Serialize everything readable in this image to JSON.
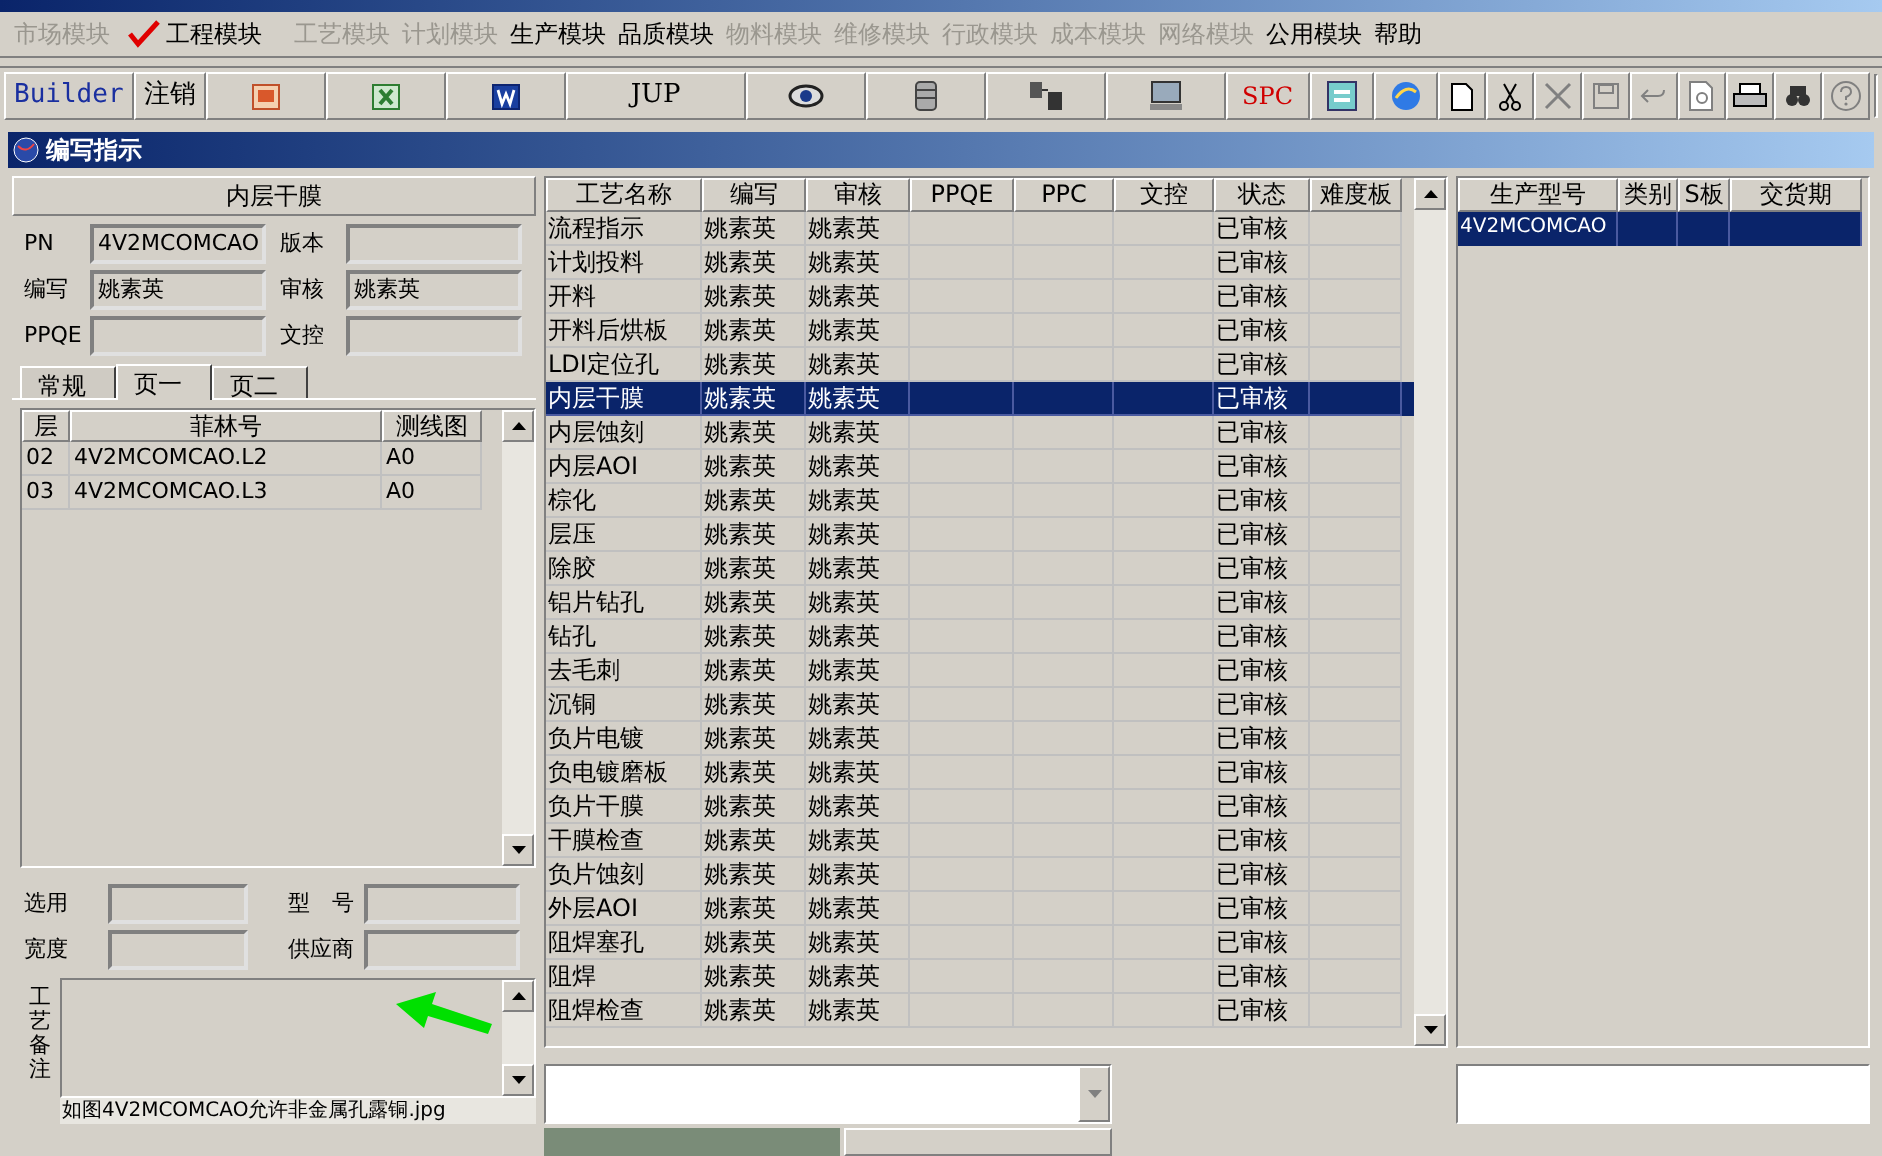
{
  "menu": [
    {
      "label": "市场模块",
      "disabled": true,
      "checked": false
    },
    {
      "label": "工程模块",
      "disabled": false,
      "checked": true
    },
    {
      "label": "工艺模块",
      "disabled": true,
      "checked": false
    },
    {
      "label": "计划模块",
      "disabled": true,
      "checked": false
    },
    {
      "label": "生产模块",
      "disabled": false,
      "checked": false
    },
    {
      "label": "品质模块",
      "disabled": false,
      "checked": false
    },
    {
      "label": "物料模块",
      "disabled": true,
      "checked": false
    },
    {
      "label": "维修模块",
      "disabled": true,
      "checked": false
    },
    {
      "label": "行政模块",
      "disabled": true,
      "checked": false
    },
    {
      "label": "成本模块",
      "disabled": true,
      "checked": false
    },
    {
      "label": "网络模块",
      "disabled": true,
      "checked": false
    },
    {
      "label": "公用模块",
      "disabled": false,
      "checked": false
    },
    {
      "label": "帮助",
      "disabled": false,
      "checked": false
    }
  ],
  "toolbar": [
    {
      "kind": "text",
      "label": "Builder"
    },
    {
      "kind": "text",
      "label": "注销"
    },
    {
      "kind": "icon"
    },
    {
      "kind": "icon"
    },
    {
      "kind": "icon"
    },
    {
      "kind": "text",
      "label": "JUP"
    },
    {
      "kind": "icon"
    },
    {
      "kind": "icon"
    },
    {
      "kind": "icon"
    },
    {
      "kind": "icon"
    },
    {
      "kind": "spc",
      "label": "SPC"
    },
    {
      "kind": "icon"
    },
    {
      "kind": "icon"
    },
    {
      "kind": "small"
    },
    {
      "kind": "small"
    },
    {
      "kind": "small"
    },
    {
      "kind": "small"
    },
    {
      "kind": "small"
    },
    {
      "kind": "small"
    },
    {
      "kind": "small"
    },
    {
      "kind": "small"
    },
    {
      "kind": "small"
    }
  ],
  "inner_window": {
    "title": "编写指示"
  },
  "left": {
    "heading": "内层干膜",
    "fields": [
      {
        "label": "PN",
        "value": "4V2MCOMCAO"
      },
      {
        "label": "版本"
      },
      {
        "label": "编写",
        "value": "姚素英"
      },
      {
        "label": "审核",
        "value": "姚素英"
      },
      {
        "label": "PPQE"
      },
      {
        "label": "文控"
      }
    ],
    "tabs": [
      {
        "label": "常规",
        "selected": false
      },
      {
        "label": "页一",
        "selected": true
      },
      {
        "label": "页二",
        "selected": false
      }
    ],
    "layer_table": {
      "columns": [
        "层",
        "菲林号",
        "测线图"
      ],
      "rows": [
        [
          "02",
          "4V2MCOMCAO.L2",
          "A0"
        ],
        [
          "03",
          "4V2MCOMCAO.L3",
          "A0"
        ]
      ]
    },
    "fields2": [
      {
        "label": "选用"
      },
      {
        "label": "型　号"
      },
      {
        "label": "宽度"
      },
      {
        "label": "供应商"
      }
    ],
    "memo_label": "工艺备注",
    "note": "如图4V2MCOMCAO允许非金属孔露铜.jpg"
  },
  "process_table": {
    "columns": [
      "工艺名称",
      "编写",
      "审核",
      "PPQE",
      "PPC",
      "文控",
      "状态",
      "难度板"
    ],
    "rows": [
      {
        "cells": [
          "流程指示",
          "姚素英",
          "姚素英",
          "",
          "",
          "",
          "已审核",
          ""
        ],
        "selected": false
      },
      {
        "cells": [
          "计划投料",
          "姚素英",
          "姚素英",
          "",
          "",
          "",
          "已审核",
          ""
        ],
        "selected": false
      },
      {
        "cells": [
          "开料",
          "姚素英",
          "姚素英",
          "",
          "",
          "",
          "已审核",
          ""
        ],
        "selected": false
      },
      {
        "cells": [
          "开料后烘板",
          "姚素英",
          "姚素英",
          "",
          "",
          "",
          "已审核",
          ""
        ],
        "selected": false
      },
      {
        "cells": [
          "LDI定位孔",
          "姚素英",
          "姚素英",
          "",
          "",
          "",
          "已审核",
          ""
        ],
        "selected": false
      },
      {
        "cells": [
          "内层干膜",
          "姚素英",
          "姚素英",
          "",
          "",
          "",
          "已审核",
          ""
        ],
        "selected": true
      },
      {
        "cells": [
          "内层蚀刻",
          "姚素英",
          "姚素英",
          "",
          "",
          "",
          "已审核",
          ""
        ],
        "selected": false
      },
      {
        "cells": [
          "内层AOI",
          "姚素英",
          "姚素英",
          "",
          "",
          "",
          "已审核",
          ""
        ],
        "selected": false
      },
      {
        "cells": [
          "棕化",
          "姚素英",
          "姚素英",
          "",
          "",
          "",
          "已审核",
          ""
        ],
        "selected": false
      },
      {
        "cells": [
          "层压",
          "姚素英",
          "姚素英",
          "",
          "",
          "",
          "已审核",
          ""
        ],
        "selected": false
      },
      {
        "cells": [
          "除胶",
          "姚素英",
          "姚素英",
          "",
          "",
          "",
          "已审核",
          ""
        ],
        "selected": false
      },
      {
        "cells": [
          "铝片钻孔",
          "姚素英",
          "姚素英",
          "",
          "",
          "",
          "已审核",
          ""
        ],
        "selected": false
      },
      {
        "cells": [
          "钻孔",
          "姚素英",
          "姚素英",
          "",
          "",
          "",
          "已审核",
          ""
        ],
        "selected": false
      },
      {
        "cells": [
          "去毛刺",
          "姚素英",
          "姚素英",
          "",
          "",
          "",
          "已审核",
          ""
        ],
        "selected": false
      },
      {
        "cells": [
          "沉铜",
          "姚素英",
          "姚素英",
          "",
          "",
          "",
          "已审核",
          ""
        ],
        "selected": false
      },
      {
        "cells": [
          "负片电镀",
          "姚素英",
          "姚素英",
          "",
          "",
          "",
          "已审核",
          ""
        ],
        "selected": false
      },
      {
        "cells": [
          "负电镀磨板",
          "姚素英",
          "姚素英",
          "",
          "",
          "",
          "已审核",
          ""
        ],
        "selected": false
      },
      {
        "cells": [
          "负片干膜",
          "姚素英",
          "姚素英",
          "",
          "",
          "",
          "已审核",
          ""
        ],
        "selected": false
      },
      {
        "cells": [
          "干膜检查",
          "姚素英",
          "姚素英",
          "",
          "",
          "",
          "已审核",
          ""
        ],
        "selected": false
      },
      {
        "cells": [
          "负片蚀刻",
          "姚素英",
          "姚素英",
          "",
          "",
          "",
          "已审核",
          ""
        ],
        "selected": false
      },
      {
        "cells": [
          "外层AOI",
          "姚素英",
          "姚素英",
          "",
          "",
          "",
          "已审核",
          ""
        ],
        "selected": false
      },
      {
        "cells": [
          "阻焊塞孔",
          "姚素英",
          "姚素英",
          "",
          "",
          "",
          "已审核",
          ""
        ],
        "selected": false
      },
      {
        "cells": [
          "阻焊",
          "姚素英",
          "姚素英",
          "",
          "",
          "",
          "已审核",
          ""
        ],
        "selected": false
      },
      {
        "cells": [
          "阻焊检查",
          "姚素英",
          "姚素英",
          "",
          "",
          "",
          "已审核",
          ""
        ],
        "selected": false
      }
    ]
  },
  "order_table": {
    "columns": [
      "生产型号",
      "类别",
      "S板",
      "交货期"
    ],
    "rows": [
      [
        "4V2MCOMCAO",
        "",
        "",
        ""
      ]
    ]
  }
}
